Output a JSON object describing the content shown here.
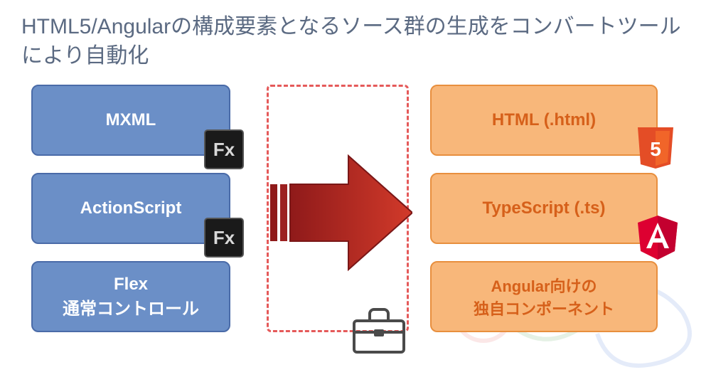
{
  "title": "HTML5/Angularの構成要素となるソース群の生成をコンバートツールにより自動化",
  "left": {
    "b1": "MXML",
    "b2": "ActionScript",
    "b3_line1": "Flex",
    "b3_line2": "通常コントロール"
  },
  "right": {
    "b1": "HTML (.html)",
    "b2": "TypeScript (.ts)",
    "b3_line1": "Angular向けの",
    "b3_line2": "独自コンポーネント"
  },
  "icons": {
    "fx_label": "Fx",
    "html5_label": "5",
    "angular_label": "A"
  },
  "colors": {
    "blue_fill": "#6b8fc7",
    "blue_border": "#4a6ba8",
    "orange_fill": "#f8b77a",
    "orange_border": "#e88f3e",
    "arrow": "#b22222",
    "dashed": "#e55a5a"
  }
}
